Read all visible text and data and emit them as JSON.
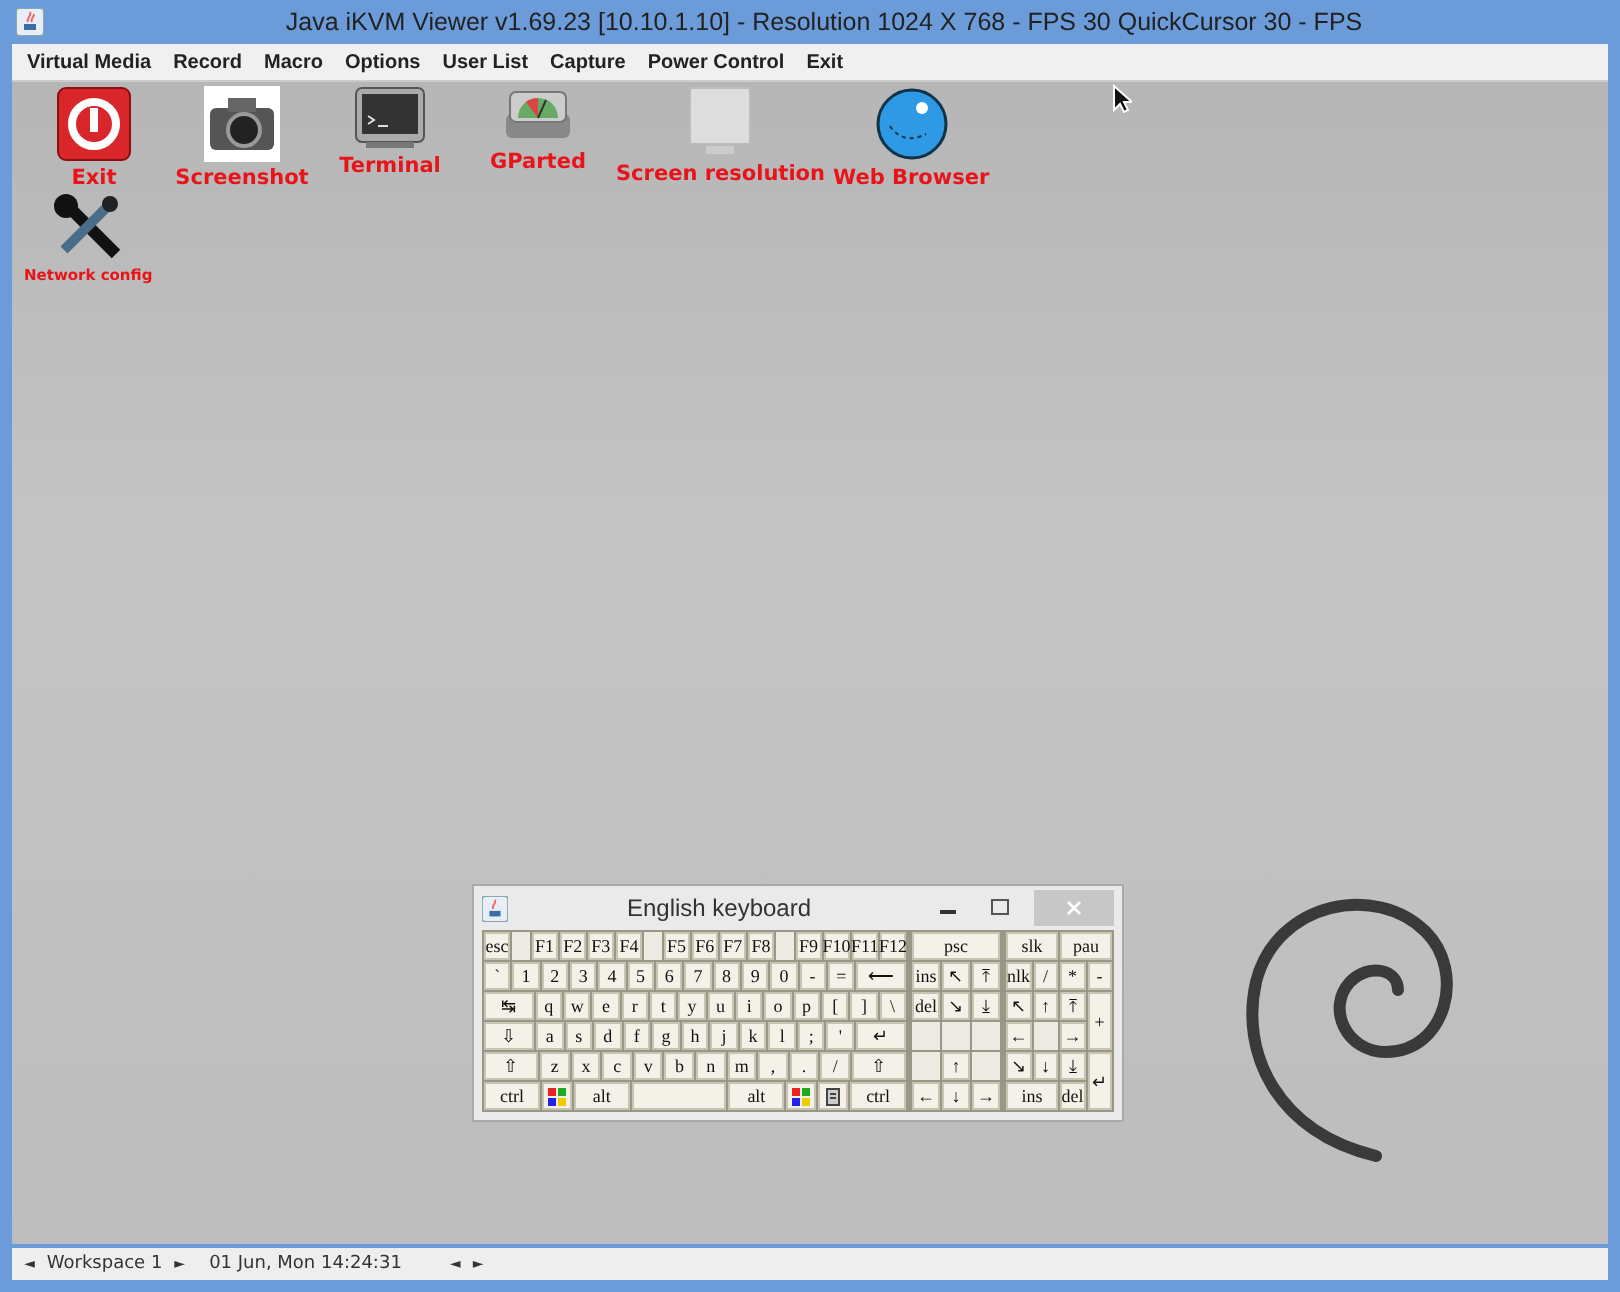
{
  "window": {
    "title": "Java iKVM Viewer v1.69.23 [10.10.1.10]  - Resolution 1024 X 768 - FPS 30 QuickCursor 30 - FPS"
  },
  "menu": [
    "Virtual Media",
    "Record",
    "Macro",
    "Options",
    "User List",
    "Capture",
    "Power Control",
    "Exit"
  ],
  "desktop_icons": [
    {
      "kind": "exit",
      "label": "Exit"
    },
    {
      "kind": "camera",
      "label": "Screenshot"
    },
    {
      "kind": "terminal",
      "label": "Terminal"
    },
    {
      "kind": "disk",
      "label": "GParted"
    },
    {
      "kind": "screen",
      "label": "Screen resolution"
    },
    {
      "kind": "globe",
      "label": "Web Browser"
    }
  ],
  "desktop_icons_row_2": [
    {
      "kind": "tools",
      "label": "Network config"
    }
  ],
  "keyboard": {
    "title": "English keyboard",
    "main_rows": [
      [
        {
          "kind": "key",
          "label": "esc"
        },
        {
          "kind": "gap"
        },
        {
          "kind": "key",
          "label": "F1"
        },
        {
          "kind": "key",
          "label": "F2"
        },
        {
          "kind": "key",
          "label": "F3"
        },
        {
          "kind": "key",
          "label": "F4"
        },
        {
          "kind": "gap"
        },
        {
          "kind": "key",
          "label": "F5"
        },
        {
          "kind": "key",
          "label": "F6"
        },
        {
          "kind": "key",
          "label": "F7"
        },
        {
          "kind": "key",
          "label": "F8"
        },
        {
          "kind": "gap"
        },
        {
          "kind": "key",
          "label": "F9"
        },
        {
          "kind": "key",
          "label": "F10"
        },
        {
          "kind": "key",
          "label": "F11"
        },
        {
          "kind": "key",
          "label": "F12"
        }
      ],
      [
        {
          "kind": "key",
          "label": "`"
        },
        {
          "kind": "key",
          "label": "1"
        },
        {
          "kind": "key",
          "label": "2"
        },
        {
          "kind": "key",
          "label": "3"
        },
        {
          "kind": "key",
          "label": "4"
        },
        {
          "kind": "key",
          "label": "5"
        },
        {
          "kind": "key",
          "label": "6"
        },
        {
          "kind": "key",
          "label": "7"
        },
        {
          "kind": "key",
          "label": "8"
        },
        {
          "kind": "key",
          "label": "9"
        },
        {
          "kind": "key",
          "label": "0"
        },
        {
          "kind": "key",
          "label": "-"
        },
        {
          "kind": "key",
          "label": "="
        },
        {
          "kind": "wide",
          "label": "⟵"
        }
      ],
      [
        {
          "kind": "wide",
          "label": "↹"
        },
        {
          "kind": "key",
          "label": "q"
        },
        {
          "kind": "key",
          "label": "w"
        },
        {
          "kind": "key",
          "label": "e"
        },
        {
          "kind": "key",
          "label": "r"
        },
        {
          "kind": "key",
          "label": "t"
        },
        {
          "kind": "key",
          "label": "y"
        },
        {
          "kind": "key",
          "label": "u"
        },
        {
          "kind": "key",
          "label": "i"
        },
        {
          "kind": "key",
          "label": "o"
        },
        {
          "kind": "key",
          "label": "p"
        },
        {
          "kind": "key",
          "label": "["
        },
        {
          "kind": "key",
          "label": "]"
        },
        {
          "kind": "key",
          "label": "\\"
        }
      ],
      [
        {
          "kind": "wide",
          "label": "⇩"
        },
        {
          "kind": "key",
          "label": "a"
        },
        {
          "kind": "key",
          "label": "s"
        },
        {
          "kind": "key",
          "label": "d"
        },
        {
          "kind": "key",
          "label": "f"
        },
        {
          "kind": "key",
          "label": "g"
        },
        {
          "kind": "key",
          "label": "h"
        },
        {
          "kind": "key",
          "label": "j"
        },
        {
          "kind": "key",
          "label": "k"
        },
        {
          "kind": "key",
          "label": "l"
        },
        {
          "kind": "key",
          "label": ";"
        },
        {
          "kind": "key",
          "label": "'"
        },
        {
          "kind": "wide",
          "label": "↵"
        }
      ],
      [
        {
          "kind": "wide",
          "label": "⇧"
        },
        {
          "kind": "key",
          "label": "z"
        },
        {
          "kind": "key",
          "label": "x"
        },
        {
          "kind": "key",
          "label": "c"
        },
        {
          "kind": "key",
          "label": "v"
        },
        {
          "kind": "key",
          "label": "b"
        },
        {
          "kind": "key",
          "label": "n"
        },
        {
          "kind": "key",
          "label": "m"
        },
        {
          "kind": "key",
          "label": ","
        },
        {
          "kind": "key",
          "label": "."
        },
        {
          "kind": "key",
          "label": "/"
        },
        {
          "kind": "wide",
          "label": "⇧"
        }
      ],
      [
        {
          "kind": "wide",
          "label": "ctrl"
        },
        {
          "kind": "logo"
        },
        {
          "kind": "wide",
          "label": "alt"
        },
        {
          "kind": "space"
        },
        {
          "kind": "wide",
          "label": "alt"
        },
        {
          "kind": "logo"
        },
        {
          "kind": "menu"
        },
        {
          "kind": "wide",
          "label": "ctrl"
        }
      ]
    ],
    "nav_keys": [
      {
        "kind": "span3",
        "label": "psc"
      },
      {
        "kind": "key",
        "label": "ins"
      },
      {
        "kind": "key",
        "label": "↖"
      },
      {
        "kind": "key",
        "label": "⤒"
      },
      {
        "kind": "key",
        "label": "del"
      },
      {
        "kind": "key",
        "label": "↘"
      },
      {
        "kind": "key",
        "label": "⤓"
      },
      {
        "kind": "gap"
      },
      {
        "kind": "gap"
      },
      {
        "kind": "gap"
      },
      {
        "kind": "gap"
      },
      {
        "kind": "key",
        "label": "↑"
      },
      {
        "kind": "gap"
      },
      {
        "kind": "key",
        "label": "←"
      },
      {
        "kind": "key",
        "label": "↓"
      },
      {
        "kind": "key",
        "label": "→"
      }
    ],
    "numpad_keys": [
      {
        "kind": "wide",
        "label": "slk"
      },
      {
        "kind": "wide",
        "label": "pau"
      },
      {
        "kind": "key",
        "label": "nlk"
      },
      {
        "kind": "key",
        "label": "/"
      },
      {
        "kind": "key",
        "label": "*"
      },
      {
        "kind": "key",
        "label": "-"
      },
      {
        "kind": "key",
        "label": "↖"
      },
      {
        "kind": "key",
        "label": "↑"
      },
      {
        "kind": "key",
        "label": "⤒"
      },
      {
        "kind": "tall",
        "label": "+"
      },
      {
        "kind": "key",
        "label": "←"
      },
      {
        "kind": "gap"
      },
      {
        "kind": "key",
        "label": "→"
      },
      {
        "kind": "key",
        "label": "↘"
      },
      {
        "kind": "key",
        "label": "↓"
      },
      {
        "kind": "key",
        "label": "⤓"
      },
      {
        "kind": "tall",
        "label": "↵"
      },
      {
        "kind": "wide",
        "label": "ins"
      },
      {
        "kind": "key",
        "label": "del"
      }
    ]
  },
  "status_bar": {
    "prev": "◄",
    "workspace": "Workspace 1",
    "next": "►",
    "datetime": "01 Jun, Mon 14:24:31",
    "nav_prev": "◄",
    "nav_next": "►"
  }
}
